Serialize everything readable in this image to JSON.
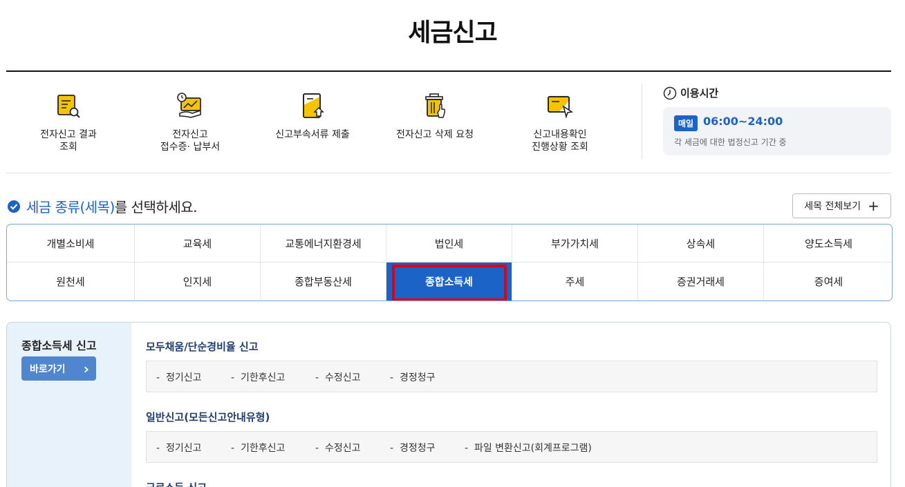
{
  "page": {
    "title": "세금신고"
  },
  "quick_menu": [
    {
      "label": "전자신고 결과\n조회",
      "icon": "report-search-icon"
    },
    {
      "label": "전자신고\n접수증· 납부서",
      "icon": "receipt-payment-icon"
    },
    {
      "label": "신고부속서류 제출",
      "icon": "document-upload-icon"
    },
    {
      "label": "전자신고 삭제 요청",
      "icon": "trash-delete-icon"
    },
    {
      "label": "신고내용확인\n진행상황 조회",
      "icon": "progress-check-icon"
    }
  ],
  "hours": {
    "title": "이용시간",
    "badge": "매일",
    "time": "06:00~24:00",
    "desc": "각 세금에 대한 법정신고 기간 중"
  },
  "select": {
    "heading_highlight": "세금 종류(세목)",
    "heading_rest": "를 선택하세요.",
    "view_all": "세목 전체보기",
    "view_all_icon": "+"
  },
  "tax_types": {
    "row1": [
      "개별소비세",
      "교육세",
      "교통에너지환경세",
      "법인세",
      "부가가치세",
      "상속세",
      "양도소득세"
    ],
    "row2": [
      "원천세",
      "인지세",
      "종합부동산세",
      "종합소득세",
      "주세",
      "증권거래세",
      "증여세"
    ],
    "selected": "종합소득세"
  },
  "panel": {
    "side_title": "종합소득세 신고",
    "go_button": "바로가기",
    "go_icon": "›",
    "sections": [
      {
        "title": "모두채움/단순경비율 신고",
        "links": [
          "정기신고",
          "기한후신고",
          "수정신고",
          "경정청구"
        ]
      },
      {
        "title": "일반신고(모든신고안내유형)",
        "links": [
          "정기신고",
          "기한후신고",
          "수정신고",
          "경정청구",
          "파일 변환신고(회계프로그램)"
        ]
      },
      {
        "title": "근로소득 신고",
        "links": []
      }
    ]
  },
  "colors": {
    "accent": "#1b63c6",
    "highlight_border": "#e00012",
    "panel_side": "#e8f2fb"
  }
}
